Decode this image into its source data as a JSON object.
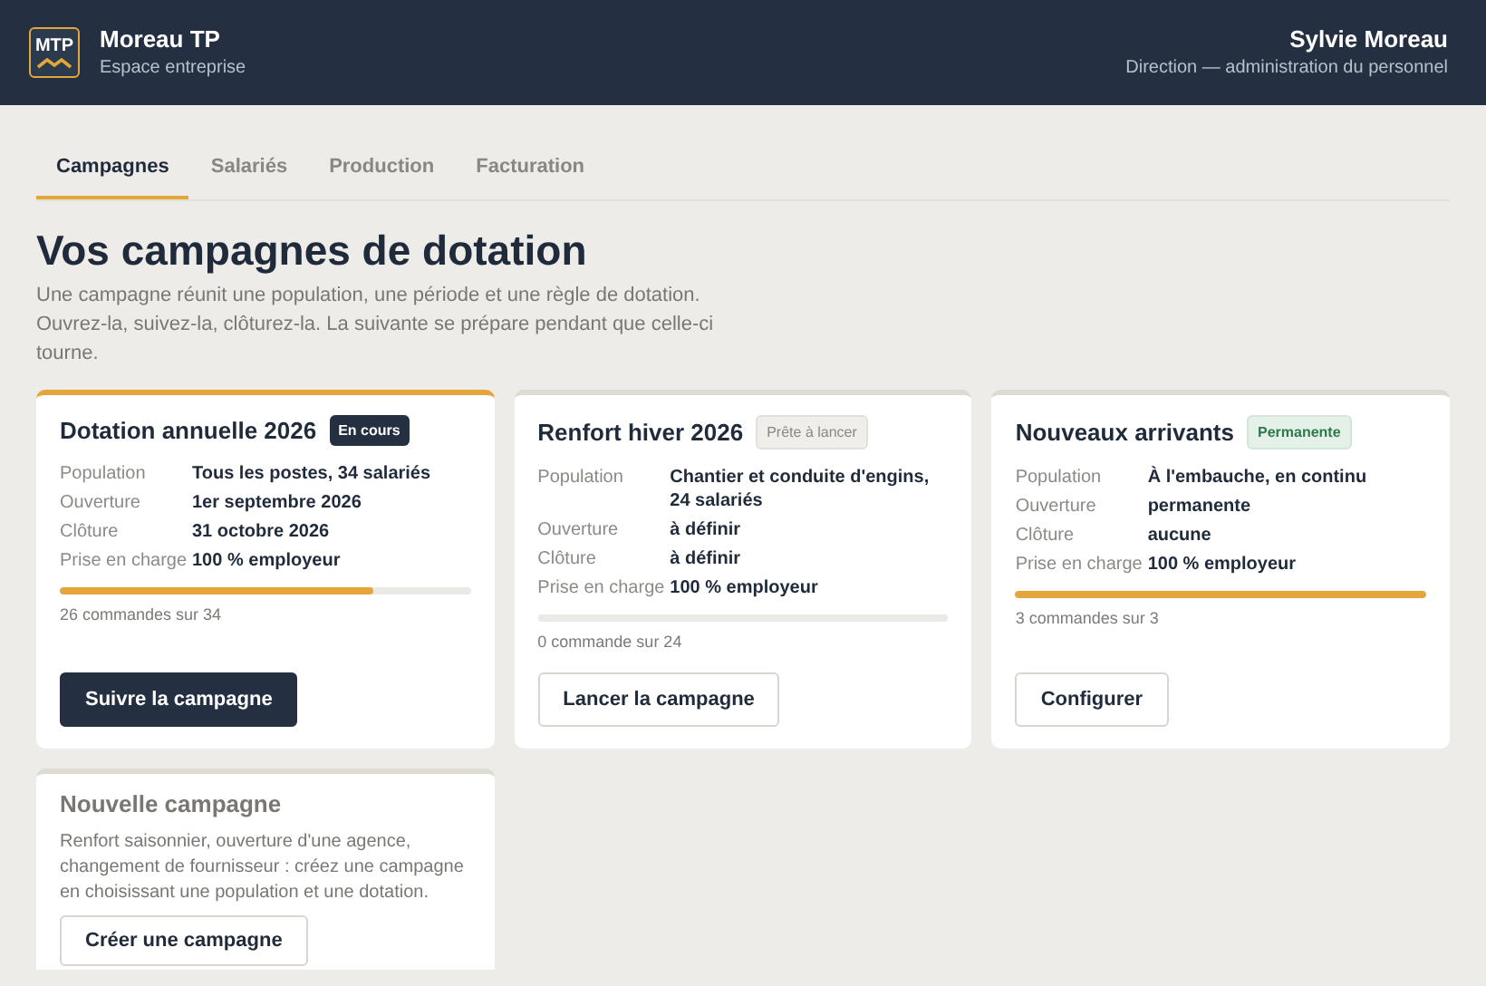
{
  "header": {
    "company": "Moreau TP",
    "logo": "MTP",
    "subtitle": "Espace entreprise",
    "user": "Sylvie Moreau",
    "role": "Direction — administration du personnel"
  },
  "tabs": [
    {
      "label": "Campagnes",
      "selected": true
    },
    {
      "label": "Salariés",
      "selected": false
    },
    {
      "label": "Production",
      "selected": false
    },
    {
      "label": "Facturation",
      "selected": false
    }
  ],
  "title": "Vos campagnes de dotation",
  "intro": "Une campagne réunit une population, une période et une règle de dotation. Ouvrez-la, suivez-la, clôturez-la. La suivante se prépare pendant que celle-ci tourne.",
  "campaigns": [
    {
      "name": "Dotation annuelle 2026",
      "active": true,
      "badge": {
        "label": "En cours",
        "kind": "running"
      },
      "details": [
        {
          "label": "Population",
          "value": "Tous les postes, 34 salariés"
        },
        {
          "label": "Ouverture",
          "value": "1er septembre 2026"
        },
        {
          "label": "Clôture",
          "value": "31 octobre 2026"
        },
        {
          "label": "Prise en charge",
          "value": "100 % employeur"
        }
      ],
      "level": 0.765,
      "progress_text": "26 commandes sur 34",
      "button": {
        "label": "Suivre la campagne",
        "kind": "primary"
      }
    },
    {
      "name": "Renfort hiver 2026",
      "active": false,
      "badge": {
        "label": "Prête à lancer",
        "kind": "ready"
      },
      "details": [
        {
          "label": "Population",
          "value": "Chantier et conduite d'engins, 24 salariés"
        },
        {
          "label": "Ouverture",
          "value": "à définir"
        },
        {
          "label": "Clôture",
          "value": "à définir"
        },
        {
          "label": "Prise en charge",
          "value": "100 % employeur"
        }
      ],
      "level": 0,
      "progress_text": "0 commande sur 24",
      "button": {
        "label": "Lancer la campagne",
        "kind": "secondary"
      }
    },
    {
      "name": "Nouveaux arrivants",
      "active": false,
      "badge": {
        "label": "Permanente",
        "kind": "permanent"
      },
      "details": [
        {
          "label": "Population",
          "value": "À l'embauche, en continu"
        },
        {
          "label": "Ouverture",
          "value": "permanente"
        },
        {
          "label": "Clôture",
          "value": "aucune"
        },
        {
          "label": "Prise en charge",
          "value": "100 % employeur"
        }
      ],
      "level": 1,
      "progress_text": "3 commandes sur 3",
      "button": {
        "label": "Configurer",
        "kind": "secondary"
      }
    }
  ],
  "new_campaign": {
    "title": "Nouvelle campagne",
    "text": "Renfort saisonnier, ouverture d'une agence, changement de fournisseur : créez une campagne en choisissant une population et une dotation.",
    "button": "Créer une campagne"
  }
}
